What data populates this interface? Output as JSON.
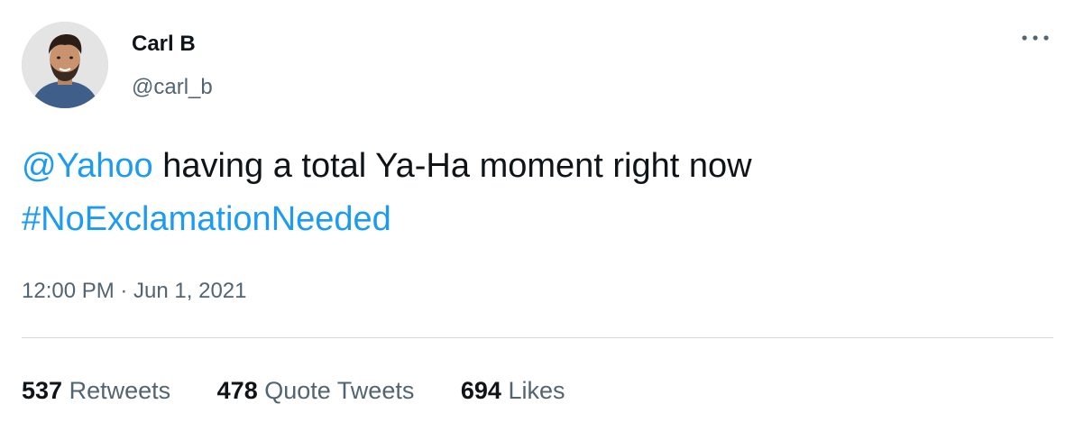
{
  "author": {
    "display_name": "Carl B",
    "handle": "@carl_b",
    "avatar_icon": "avatar-photo"
  },
  "menu": {
    "icon": "more-horizontal-icon"
  },
  "tweet": {
    "mention": "@Yahoo",
    "text": " having a total Ya-Ha moment right now",
    "hashtag": "#NoExclamationNeeded"
  },
  "timestamp": "12:00 PM · Jun 1, 2021",
  "stats": {
    "retweets": {
      "count": "537",
      "label": "Retweets"
    },
    "quote_tweets": {
      "count": "478",
      "label": "Quote Tweets"
    },
    "likes": {
      "count": "694",
      "label": "Likes"
    }
  },
  "colors": {
    "link": "#1d9bf0",
    "secondary_text": "#536471",
    "primary_text": "#0f1419",
    "divider": "#cfd9de"
  }
}
